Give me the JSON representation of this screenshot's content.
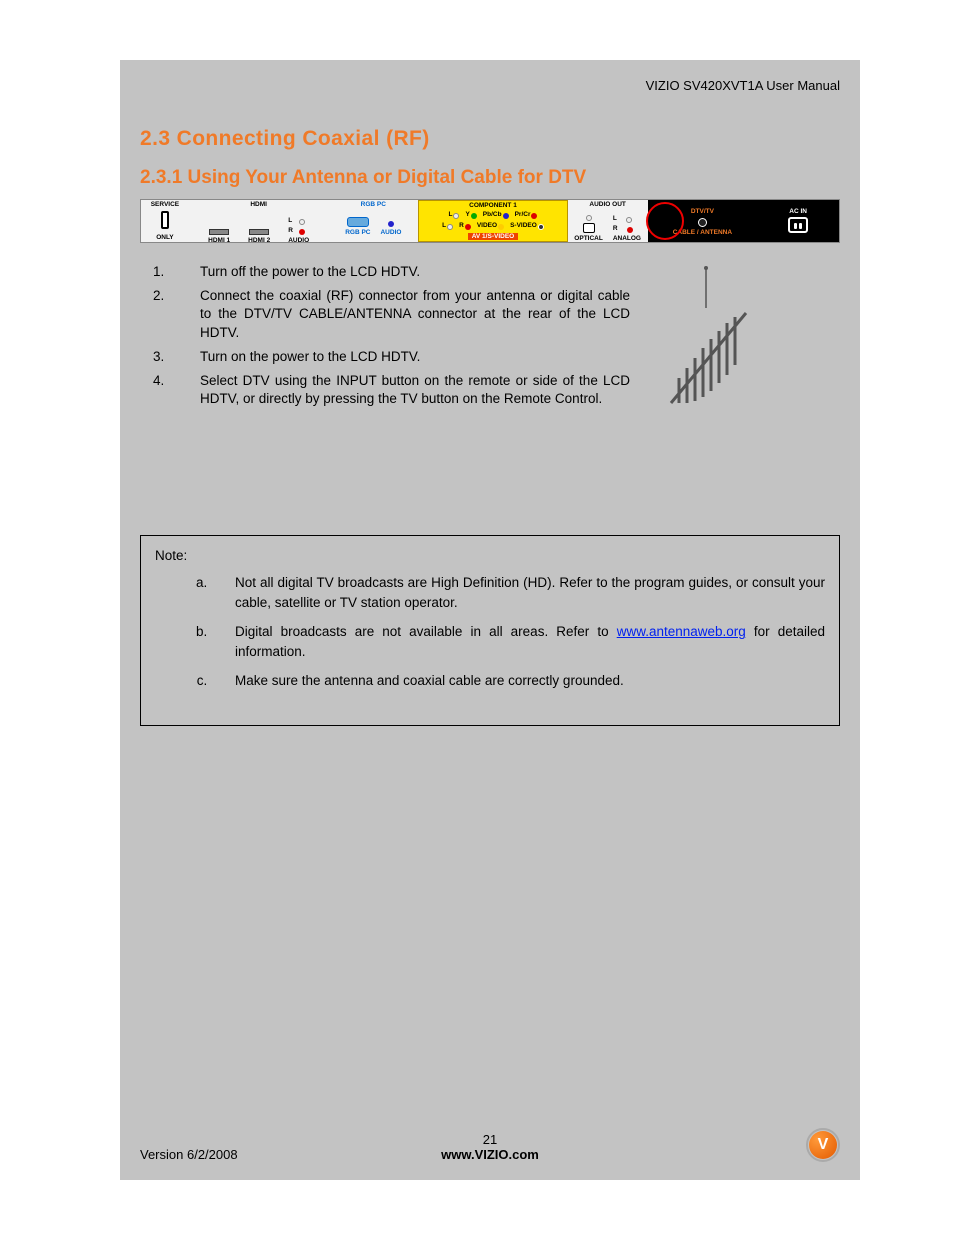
{
  "header": {
    "doc_title": "VIZIO SV420XVT1A User Manual"
  },
  "headings": {
    "h1": "2.3 Connecting Coaxial (RF)",
    "h2": "2.3.1 Using Your Antenna or Digital Cable for DTV"
  },
  "panel": {
    "service": "SERVICE",
    "only": "ONLY",
    "hdmi": "HDMI",
    "hdmi1": "HDMI 1",
    "hdmi2": "HDMI 2",
    "l": "L",
    "r": "R",
    "audio": "AUDIO",
    "rgb_pc": "RGB PC",
    "component1": "COMPONENT 1",
    "y": "Y",
    "pbcb": "Pb/Cb",
    "prcr": "Pr/Cr",
    "video": "VIDEO",
    "svideo": "S-VIDEO",
    "av1s": "AV 1/S-VIDEO",
    "audio_out": "AUDIO OUT",
    "optical": "OPTICAL",
    "analog": "ANALOG",
    "dtvtv": "DTV/TV",
    "cable_ant": "CABLE / ANTENNA",
    "ac_in": "AC IN"
  },
  "steps": [
    "Turn off the power to the LCD HDTV.",
    "Connect the coaxial (RF) connector from your antenna or digital cable to the DTV/TV CABLE/ANTENNA connector at the rear of the LCD HDTV.",
    "Turn on the power to the LCD HDTV.",
    "Select DTV using the INPUT button on the remote or side of the LCD HDTV, or directly by pressing the TV button on the Remote Control."
  ],
  "note": {
    "title": "Note:",
    "a_pre": "Not all digital TV broadcasts are High Definition (HD).  Refer to the program guides, or consult your cable, satellite or TV station operator.",
    "b_pre": "Digital broadcasts are not available in all areas.  Refer to ",
    "b_link": "www.antennaweb.org",
    "b_post": " for detailed information.",
    "c": "Make sure the antenna and coaxial cable are correctly grounded."
  },
  "footer": {
    "version": "Version 6/2/2008",
    "page": "21",
    "url": "www.VIZIO.com"
  }
}
